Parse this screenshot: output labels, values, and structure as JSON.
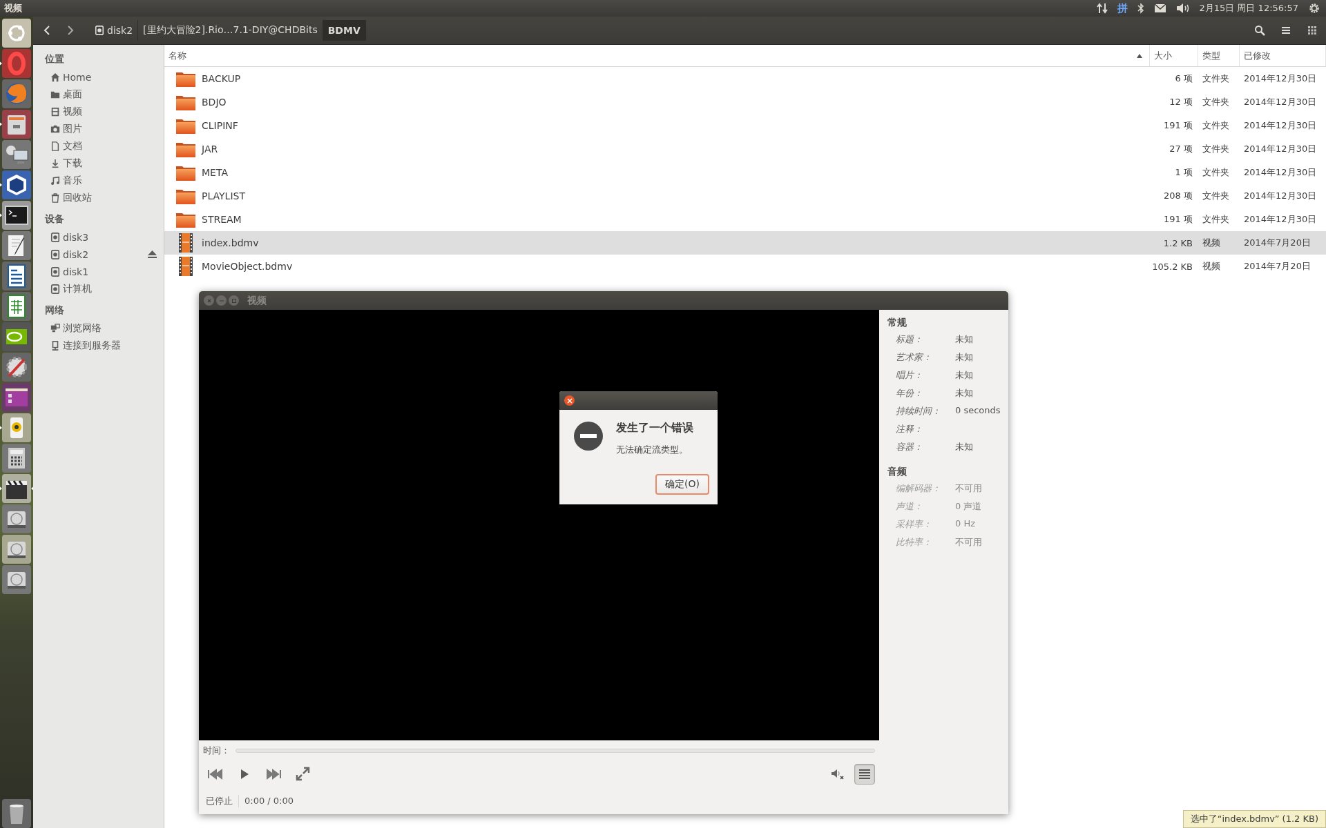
{
  "top_bar": {
    "title": "视频",
    "input_method": "拼",
    "clock": "2月15日 周日 12:56:57"
  },
  "launcher": [
    {
      "running": false,
      "focused": false
    },
    {
      "running": true,
      "focused": false
    },
    {
      "running": false,
      "focused": false
    },
    {
      "running": true,
      "focused": false
    },
    {
      "running": false,
      "focused": false
    },
    {
      "running": true,
      "focused": false
    },
    {
      "running": true,
      "focused": false
    },
    {
      "running": false,
      "focused": false
    },
    {
      "running": false,
      "focused": false
    },
    {
      "running": false,
      "focused": false
    },
    {
      "running": false,
      "focused": false
    },
    {
      "running": false,
      "focused": false
    },
    {
      "running": false,
      "focused": false
    },
    {
      "running": true,
      "focused": false
    },
    {
      "running": false,
      "focused": false
    },
    {
      "running": true,
      "focused": true
    },
    {
      "running": false,
      "focused": false
    },
    {
      "running": false,
      "focused": false
    },
    {
      "running": false,
      "focused": false
    },
    {
      "running": false,
      "focused": false
    }
  ],
  "toolbar": {
    "path": [
      {
        "label": "disk2",
        "selected": false
      },
      {
        "label": "[里约大冒险2].Rio…7.1-DIY@CHDBits",
        "selected": false
      },
      {
        "label": "BDMV",
        "selected": true
      }
    ]
  },
  "sidebar": {
    "sections": [
      {
        "heading": "位置",
        "items": [
          {
            "label": "Home",
            "eject": false
          },
          {
            "label": "桌面",
            "eject": false
          },
          {
            "label": "视频",
            "eject": false
          },
          {
            "label": "图片",
            "eject": false
          },
          {
            "label": "文档",
            "eject": false
          },
          {
            "label": "下载",
            "eject": false
          },
          {
            "label": "音乐",
            "eject": false
          },
          {
            "label": "回收站",
            "eject": false
          }
        ]
      },
      {
        "heading": "设备",
        "items": [
          {
            "label": "disk3",
            "eject": false
          },
          {
            "label": "disk2",
            "eject": true
          },
          {
            "label": "disk1",
            "eject": false
          },
          {
            "label": "计算机",
            "eject": false
          }
        ]
      },
      {
        "heading": "网络",
        "items": [
          {
            "label": "浏览网络",
            "eject": false
          },
          {
            "label": "连接到服务器",
            "eject": false
          }
        ]
      }
    ]
  },
  "table": {
    "columns": [
      {
        "label": "名称",
        "sorted": true
      },
      {
        "label": "大小",
        "sorted": false
      },
      {
        "label": "类型",
        "sorted": false
      },
      {
        "label": "已修改",
        "sorted": false
      }
    ],
    "rows": [
      {
        "kind": "folder",
        "name": "BACKUP",
        "size": "6 项",
        "type": "文件夹",
        "modified": "2014年12月30日",
        "selected": false
      },
      {
        "kind": "folder",
        "name": "BDJO",
        "size": "12 项",
        "type": "文件夹",
        "modified": "2014年12月30日",
        "selected": false
      },
      {
        "kind": "folder",
        "name": "CLIPINF",
        "size": "191 项",
        "type": "文件夹",
        "modified": "2014年12月30日",
        "selected": false
      },
      {
        "kind": "folder",
        "name": "JAR",
        "size": "27 项",
        "type": "文件夹",
        "modified": "2014年12月30日",
        "selected": false
      },
      {
        "kind": "folder",
        "name": "META",
        "size": "1 项",
        "type": "文件夹",
        "modified": "2014年12月30日",
        "selected": false
      },
      {
        "kind": "folder",
        "name": "PLAYLIST",
        "size": "208 项",
        "type": "文件夹",
        "modified": "2014年12月30日",
        "selected": false
      },
      {
        "kind": "folder",
        "name": "STREAM",
        "size": "191 项",
        "type": "文件夹",
        "modified": "2014年12月30日",
        "selected": false
      },
      {
        "kind": "video",
        "name": "index.bdmv",
        "size": "1.2 KB",
        "type": "视频",
        "modified": "2014年7月20日",
        "selected": true
      },
      {
        "kind": "video",
        "name": "MovieObject.bdmv",
        "size": "105.2 KB",
        "type": "视频",
        "modified": "2014年7月20日",
        "selected": false
      }
    ]
  },
  "video_window": {
    "title": "视频",
    "sections": [
      {
        "heading": "常规",
        "disabled": false,
        "fields": [
          {
            "label": "标题：",
            "value": "未知"
          },
          {
            "label": "艺术家：",
            "value": "未知"
          },
          {
            "label": "唱片：",
            "value": "未知"
          },
          {
            "label": "年份：",
            "value": "未知"
          },
          {
            "label": "持续时间：",
            "value": "0 seconds"
          },
          {
            "label": "注释："
          },
          {
            "label": "容器：",
            "value": "未知"
          }
        ]
      },
      {
        "heading": "音频",
        "disabled": true,
        "fields": [
          {
            "label": "编解码器：",
            "value": "不可用"
          },
          {
            "label": "声道：",
            "value": "0 声道"
          },
          {
            "label": "采样率：",
            "value": "0 Hz"
          },
          {
            "label": "比特率：",
            "value": "不可用"
          }
        ]
      }
    ],
    "time_label": "时间：",
    "seek": {
      "level": 0
    },
    "sidebar_toggle": {
      "on": true
    },
    "status": "已停止",
    "time": "0:00 / 0:00"
  },
  "dialog": {
    "heading": "发生了一个错误",
    "message": "无法确定流类型。",
    "button": "确定(O)"
  },
  "status_tooltip": "选中了“index.bdmv” (1.2 KB)"
}
